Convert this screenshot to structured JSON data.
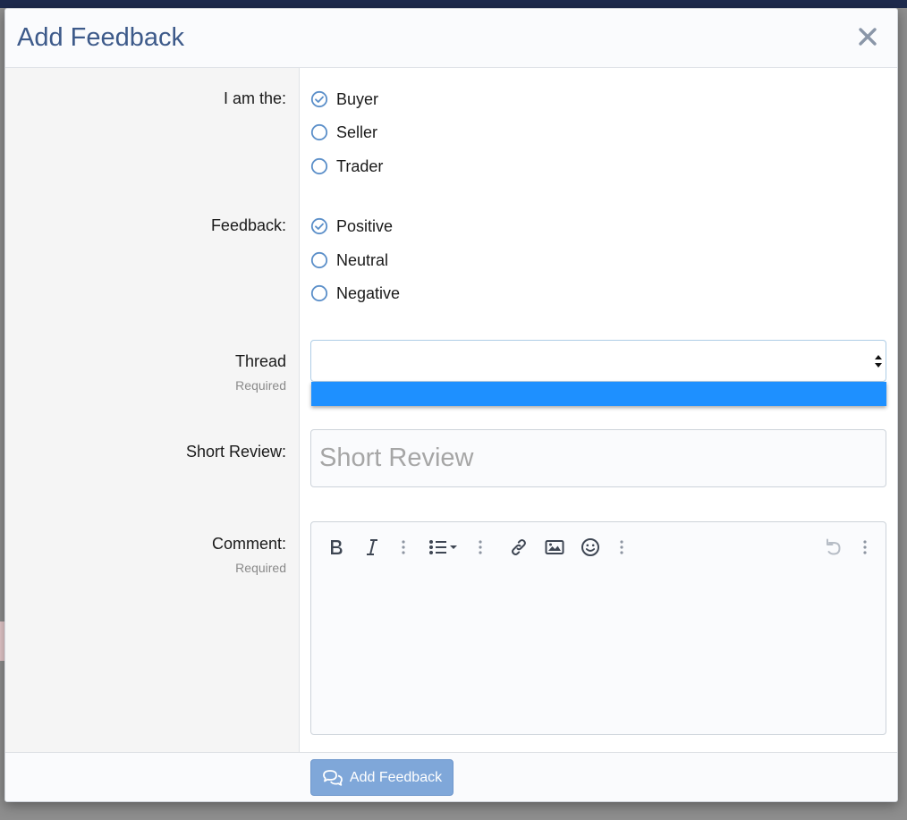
{
  "modal": {
    "title": "Add Feedback",
    "submit_label": "Add Feedback"
  },
  "form": {
    "role": {
      "label": "I am the:",
      "options": [
        {
          "label": "Buyer",
          "checked": true
        },
        {
          "label": "Seller",
          "checked": false
        },
        {
          "label": "Trader",
          "checked": false
        }
      ]
    },
    "feedback": {
      "label": "Feedback:",
      "options": [
        {
          "label": "Positive",
          "checked": true
        },
        {
          "label": "Neutral",
          "checked": false
        },
        {
          "label": "Negative",
          "checked": false
        }
      ]
    },
    "thread": {
      "label": "Thread",
      "hint": "Required",
      "value": ""
    },
    "short_review": {
      "label": "Short Review:",
      "placeholder": "Short Review",
      "value": ""
    },
    "comment": {
      "label": "Comment:",
      "hint": "Required",
      "toolbar": [
        "bold-icon",
        "italic-icon",
        "more-vertical-icon",
        "list-icon",
        "more-vertical-icon",
        "link-icon",
        "image-icon",
        "smiley-icon",
        "more-vertical-icon",
        "undo-icon",
        "more-vertical-icon"
      ]
    }
  },
  "colors": {
    "title": "#3d5a8a",
    "radio_accent": "#5b8fc9",
    "select_highlight": "#1e90ff",
    "submit_button": "#7fa7d9"
  }
}
